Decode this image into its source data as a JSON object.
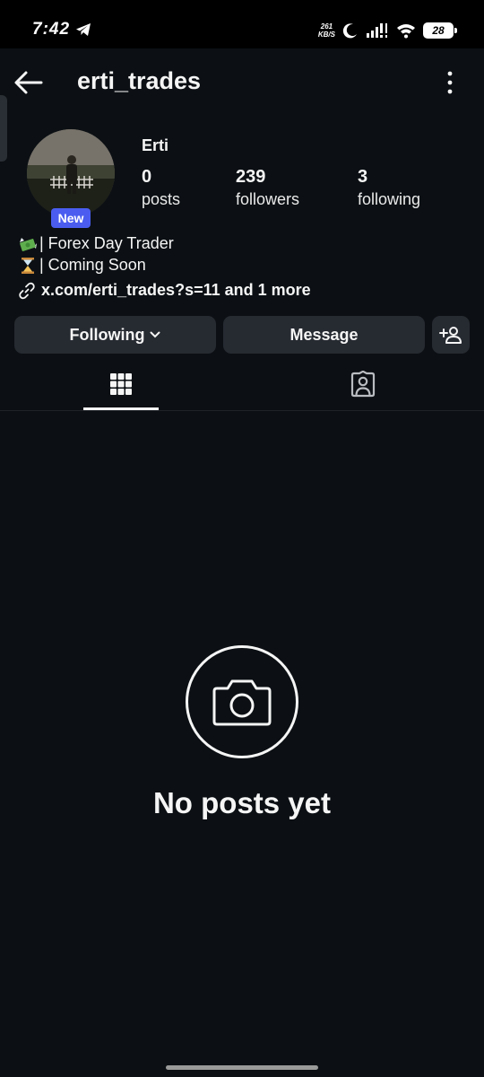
{
  "status_bar": {
    "time": "7:42",
    "net_speed_value": "261",
    "net_speed_unit": "KB/S",
    "battery": "28"
  },
  "header": {
    "username": "erti_trades"
  },
  "profile": {
    "display_name": "Erti",
    "badge": "New",
    "stats": [
      {
        "value": "0",
        "label": "posts"
      },
      {
        "value": "239",
        "label": "followers"
      },
      {
        "value": "3",
        "label": "following"
      }
    ],
    "bio": [
      {
        "icon": "money-with-wings-emoji",
        "text": "| Forex Day Trader"
      },
      {
        "icon": "hourglass-emoji",
        "text": "| Coming Soon"
      }
    ],
    "link": "x.com/erti_trades?s=11 and 1 more"
  },
  "actions": {
    "following_label": "Following",
    "message_label": "Message"
  },
  "tabs": [
    {
      "icon": "grid-icon",
      "active": true
    },
    {
      "icon": "tagged-person-icon",
      "active": false
    }
  ],
  "empty_state": {
    "icon": "camera-icon",
    "title": "No posts yet"
  },
  "colors": {
    "background": "#0c1014",
    "button": "#262a31",
    "badge": "#4a5df0"
  }
}
